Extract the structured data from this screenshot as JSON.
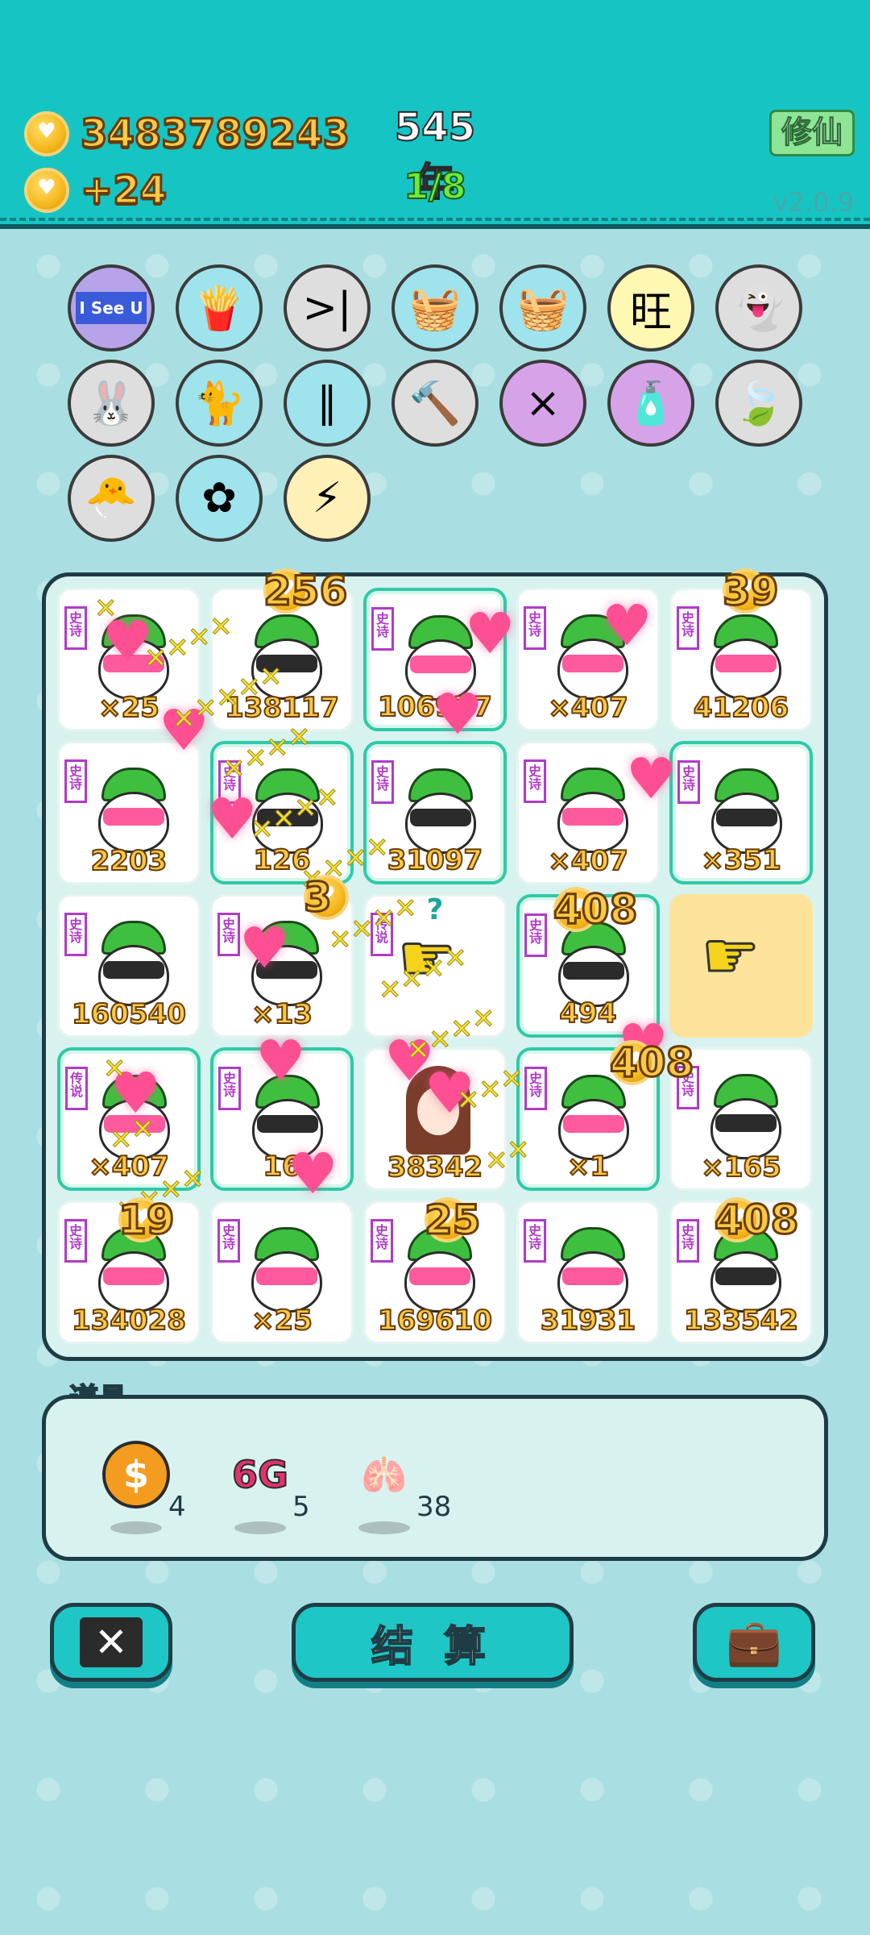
{
  "header": {
    "coins": "3483789243",
    "coin_rate": "+24",
    "year": "545年",
    "wave": "1/8",
    "cultivate_label": "修仙",
    "version": "v2.0.9"
  },
  "items_bar": [
    {
      "name": "i-see-u-icon",
      "glyph": "I See U",
      "bg": "#b7a3e8"
    },
    {
      "name": "fries-icon",
      "glyph": "🍟",
      "bg": "#9fe3ec"
    },
    {
      "name": "skip-icon",
      "glyph": ">|",
      "bg": "#dedede"
    },
    {
      "name": "fruit-basket-icon",
      "glyph": "🧺",
      "bg": "#9fe3ec"
    },
    {
      "name": "fruit-basket-icon",
      "glyph": "🧺",
      "bg": "#9fe3ec"
    },
    {
      "name": "wang-icon",
      "glyph": "旺",
      "bg": "#fff8b3"
    },
    {
      "name": "ghost-icon",
      "glyph": "👻",
      "bg": "#dedede"
    },
    {
      "name": "rabbit-icon",
      "glyph": "🐰",
      "bg": "#dedede"
    },
    {
      "name": "cat-icon",
      "glyph": "🐈",
      "bg": "#9fe3ec"
    },
    {
      "name": "chopsticks-icon",
      "glyph": "∥",
      "bg": "#9fe3ec"
    },
    {
      "name": "hammer-icon",
      "glyph": "🔨",
      "bg": "#dedede"
    },
    {
      "name": "multiplier-head-icon",
      "glyph": "×",
      "bg": "#d7a3e8"
    },
    {
      "name": "sprayer-icon",
      "glyph": "🧴",
      "bg": "#d7a3e8"
    },
    {
      "name": "leaf-icon",
      "glyph": "🍃",
      "bg": "#dedede"
    },
    {
      "name": "chick-egg-icon",
      "glyph": "🐣",
      "bg": "#dedede"
    },
    {
      "name": "flower-pot-icon",
      "glyph": "✿",
      "bg": "#9fe3ec"
    },
    {
      "name": "lightning-icon",
      "glyph": "⚡",
      "bg": "#fff0b8"
    }
  ],
  "tiles": [
    {
      "tag": "史诗",
      "num": "×25",
      "face": "love",
      "hl": false
    },
    {
      "tag": "",
      "num": "138117",
      "face": "shades",
      "hl": false
    },
    {
      "tag": "史诗",
      "num": "106977",
      "face": "love",
      "hl": true
    },
    {
      "tag": "史诗",
      "num": "×407",
      "face": "love",
      "hl": false
    },
    {
      "tag": "史诗",
      "num": "41206",
      "face": "love",
      "hl": false
    },
    {
      "tag": "史诗",
      "num": "2203",
      "face": "love",
      "hl": false
    },
    {
      "tag": "史诗",
      "num": "126",
      "face": "shades",
      "hl": true
    },
    {
      "tag": "史诗",
      "num": "31097",
      "face": "shades",
      "hl": true
    },
    {
      "tag": "史诗",
      "num": "×407",
      "face": "love",
      "hl": false
    },
    {
      "tag": "史诗",
      "num": "×351",
      "face": "shades",
      "hl": true
    },
    {
      "tag": "史诗",
      "num": "160540",
      "face": "shades",
      "hl": false
    },
    {
      "tag": "史诗",
      "num": "×13",
      "face": "shades",
      "hl": false
    },
    {
      "tag": "传说",
      "num": "?",
      "face": "pointer",
      "hl": false
    },
    {
      "tag": "史诗",
      "num": "494",
      "face": "shades",
      "hl": true
    },
    {
      "tag": "",
      "num": "",
      "face": "pointer-yellow",
      "hl": false
    },
    {
      "tag": "传说",
      "num": "×407",
      "face": "love",
      "hl": true
    },
    {
      "tag": "史诗",
      "num": "16",
      "face": "shades",
      "hl": true
    },
    {
      "tag": "",
      "num": "38342",
      "face": "girl",
      "hl": false
    },
    {
      "tag": "史诗",
      "num": "×1",
      "face": "love",
      "hl": true
    },
    {
      "tag": "史诗",
      "num": "×165",
      "face": "shades",
      "hl": false
    },
    {
      "tag": "史诗",
      "num": "134028",
      "face": "love",
      "hl": false
    },
    {
      "tag": "史诗",
      "num": "×25",
      "face": "love",
      "hl": false
    },
    {
      "tag": "史诗",
      "num": "169610",
      "face": "love",
      "hl": false
    },
    {
      "tag": "史诗",
      "num": "31931",
      "face": "love",
      "hl": false
    },
    {
      "tag": "史诗",
      "num": "133542",
      "face": "shades",
      "hl": false
    }
  ],
  "floating": [
    {
      "text": "256"
    },
    {
      "text": "39"
    },
    {
      "text": "408"
    },
    {
      "text": "408"
    },
    {
      "text": "19"
    },
    {
      "text": "25"
    },
    {
      "text": "408"
    },
    {
      "text": "3"
    }
  ],
  "props": {
    "title": "道具",
    "list": [
      {
        "name": "coin-prop-icon",
        "glyph": "$",
        "count": "4",
        "color": "#f39c1f"
      },
      {
        "name": "6g-prop-icon",
        "glyph": "6G",
        "count": "5",
        "color": "#e0326e"
      },
      {
        "name": "liver-prop-icon",
        "glyph": "🫁",
        "count": "38",
        "color": "#e5566a"
      }
    ]
  },
  "buttons": {
    "close_glyph": "✕",
    "settle_label": "结 算",
    "bag_glyph": "💼"
  }
}
